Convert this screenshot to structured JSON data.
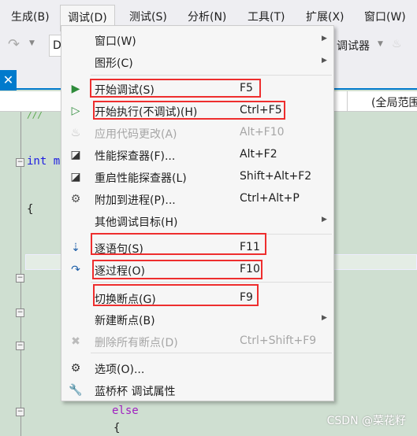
{
  "menubar": [
    "生成(B)",
    "调试(D)",
    "测试(S)",
    "分析(N)",
    "工具(T)",
    "扩展(X)",
    "窗口(W)"
  ],
  "toolbar": {
    "config_value": "D",
    "debugger_label": "调试器"
  },
  "navbar": {
    "scope": "(全局范围"
  },
  "code": {
    "int_line": "int m",
    "brace": "{",
    "else_kw": "else",
    "comment": "///"
  },
  "menu": {
    "items": [
      {
        "label": "窗口(W)",
        "shortcut": "",
        "submenu": true,
        "icon": ""
      },
      {
        "label": "图形(C)",
        "shortcut": "",
        "submenu": true,
        "icon": ""
      },
      {
        "label": "开始调试(S)",
        "shortcut": "F5",
        "icon": "play-icon"
      },
      {
        "label": "开始执行(不调试)(H)",
        "shortcut": "Ctrl+F5",
        "icon": "play-outline-icon"
      },
      {
        "label": "应用代码更改(A)",
        "shortcut": "Alt+F10",
        "icon": "flame-icon",
        "disabled": true
      },
      {
        "label": "性能探查器(F)...",
        "shortcut": "Alt+F2",
        "icon": "performance-chart-icon"
      },
      {
        "label": "重启性能探查器(L)",
        "shortcut": "Shift+Alt+F2",
        "icon": "performance-chart-icon"
      },
      {
        "label": "附加到进程(P)...",
        "shortcut": "Ctrl+Alt+P",
        "icon": "gears-icon"
      },
      {
        "label": "其他调试目标(H)",
        "shortcut": "",
        "submenu": true,
        "icon": ""
      },
      {
        "label": "逐语句(S)",
        "shortcut": "F11",
        "icon": "step-into-icon"
      },
      {
        "label": "逐过程(O)",
        "shortcut": "F10",
        "icon": "step-over-icon"
      },
      {
        "label": "切换断点(G)",
        "shortcut": "F9",
        "icon": ""
      },
      {
        "label": "新建断点(B)",
        "shortcut": "",
        "submenu": true,
        "icon": ""
      },
      {
        "label": "删除所有断点(D)",
        "shortcut": "Ctrl+Shift+F9",
        "icon": "delete-breakpoints-icon",
        "disabled": true
      },
      {
        "label": "选项(O)...",
        "shortcut": "",
        "icon": "gear-icon"
      },
      {
        "label": "蓝桥杯 调试属性",
        "shortcut": "",
        "icon": "wrench-icon"
      }
    ]
  },
  "watermark": "CSDN @菜花籽",
  "colors": {
    "highlight_box": "#ee2e2e",
    "accent": "#007acc",
    "play_green": "#2e8b3a",
    "step_blue": "#1e5fa8"
  }
}
